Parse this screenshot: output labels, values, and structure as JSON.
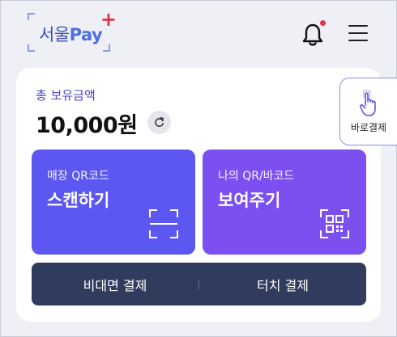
{
  "header": {
    "logo_text": "서울Pay",
    "logo_text_main": "서울",
    "logo_text_pay": "Pay",
    "logo_plus": "+",
    "bell_icon": "bell-icon",
    "menu_icon": "hamburger-menu-icon",
    "notification_badge_color": "#e0344a"
  },
  "balance": {
    "label": "총 보유금액",
    "amount": "10,000원",
    "refresh_icon": "refresh-icon"
  },
  "direct_pay": {
    "label": "바로결제",
    "icon": "hand-tap-icon"
  },
  "tiles": {
    "qr_scan": {
      "small": "매장 QR코드",
      "big": "스캔하기",
      "icon": "scan-icon",
      "color": "#5b57f0"
    },
    "my_code": {
      "small": "나의 QR/바코드",
      "big": "보여주기",
      "icon": "qr-code-icon",
      "color": "#7b4ff0"
    }
  },
  "bottom_bar": {
    "left": "비대면 결제",
    "right": "터치 결제",
    "color": "#313b5e"
  },
  "colors": {
    "background": "#eef0f6",
    "accent": "#4b43c8"
  }
}
